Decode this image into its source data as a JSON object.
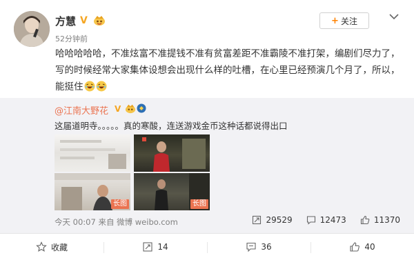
{
  "post": {
    "author": "方慧",
    "time": "52分钟前",
    "follow_label": "关注",
    "text": "哈哈哈哈哈，不准炫富不准提钱不准有贫富差距不准霸陵不准打架，编剧们尽力了，写的时候经常大家集体设想会出现什么样的吐槽，在心里已经预演几个月了，所以，能挺住",
    "emoji_icons": [
      "laughing-emoji-icon",
      "laughing-emoji-icon"
    ]
  },
  "repost": {
    "author": "@江南大野花",
    "text": "这届道明寺。。。。。真的寒酸，连送游戏金币这种话都说得出口",
    "images": [
      {
        "icon": "drama-still-image",
        "badge": ""
      },
      {
        "icon": "drama-still-image",
        "badge": ""
      },
      {
        "icon": "drama-still-image",
        "badge": "长图"
      },
      {
        "icon": "drama-still-image",
        "badge": "长图"
      }
    ],
    "time_source": "今天 00:07 来自 微博 weibo.com",
    "stats": {
      "reposts": "29529",
      "comments": "12473",
      "likes": "11370"
    }
  },
  "footer": {
    "favorite": "收藏",
    "repost": "14",
    "comment": "36",
    "like": "40"
  },
  "colors": {
    "link_orange": "#eb7350",
    "badge_gold": "#f5a623",
    "repost_bg": "#f2f2f5"
  }
}
